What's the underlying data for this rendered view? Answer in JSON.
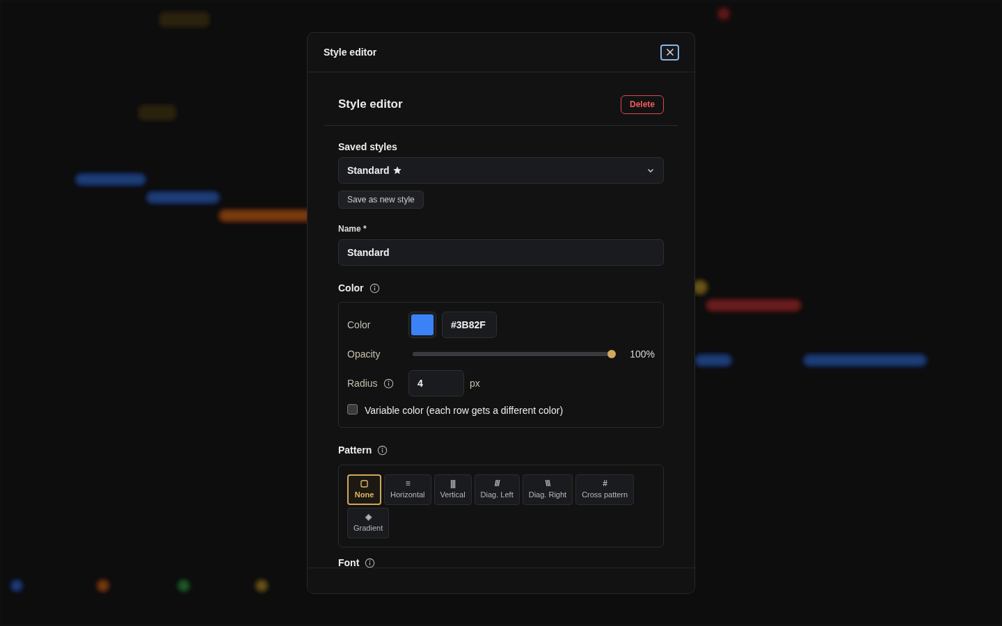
{
  "dialog": {
    "title": "Style editor"
  },
  "editor": {
    "title": "Style editor",
    "delete_label": "Delete",
    "saved_styles": {
      "label": "Saved styles",
      "value": "Standard",
      "starred": true
    },
    "save_new_label": "Save as new style",
    "name_field": {
      "label": "Name *",
      "value": "Standard"
    },
    "color_section": {
      "label": "Color",
      "color_row": {
        "label": "Color",
        "color": "#3b82f6",
        "hex": "#3B82F"
      },
      "opacity_row": {
        "label": "Opacity",
        "level": 1,
        "reading": "100%"
      },
      "radius_row": {
        "label": "Radius",
        "value": "4",
        "unit": "px"
      },
      "variable_color": {
        "label": "Variable color (each row gets a different color)",
        "checked": false
      }
    },
    "pattern_section": {
      "label": "Pattern",
      "options": [
        {
          "kind": "none",
          "label": "None",
          "selected": true
        },
        {
          "kind": "glyph",
          "glyph": "≡",
          "label": "Horizontal",
          "selected": false
        },
        {
          "kind": "glyph",
          "glyph": "|||",
          "label": "Vertical",
          "selected": false
        },
        {
          "kind": "glyph",
          "glyph": "///",
          "label": "Diag. Left",
          "selected": false
        },
        {
          "kind": "glyph",
          "glyph": "\\\\\\",
          "label": "Diag. Right",
          "selected": false
        },
        {
          "kind": "glyph",
          "glyph": "#",
          "label": "Cross pattern",
          "selected": false
        },
        {
          "kind": "glyph",
          "glyph": "◈",
          "label": "Gradient",
          "selected": false
        }
      ]
    },
    "font_section": {
      "label": "Font"
    }
  }
}
